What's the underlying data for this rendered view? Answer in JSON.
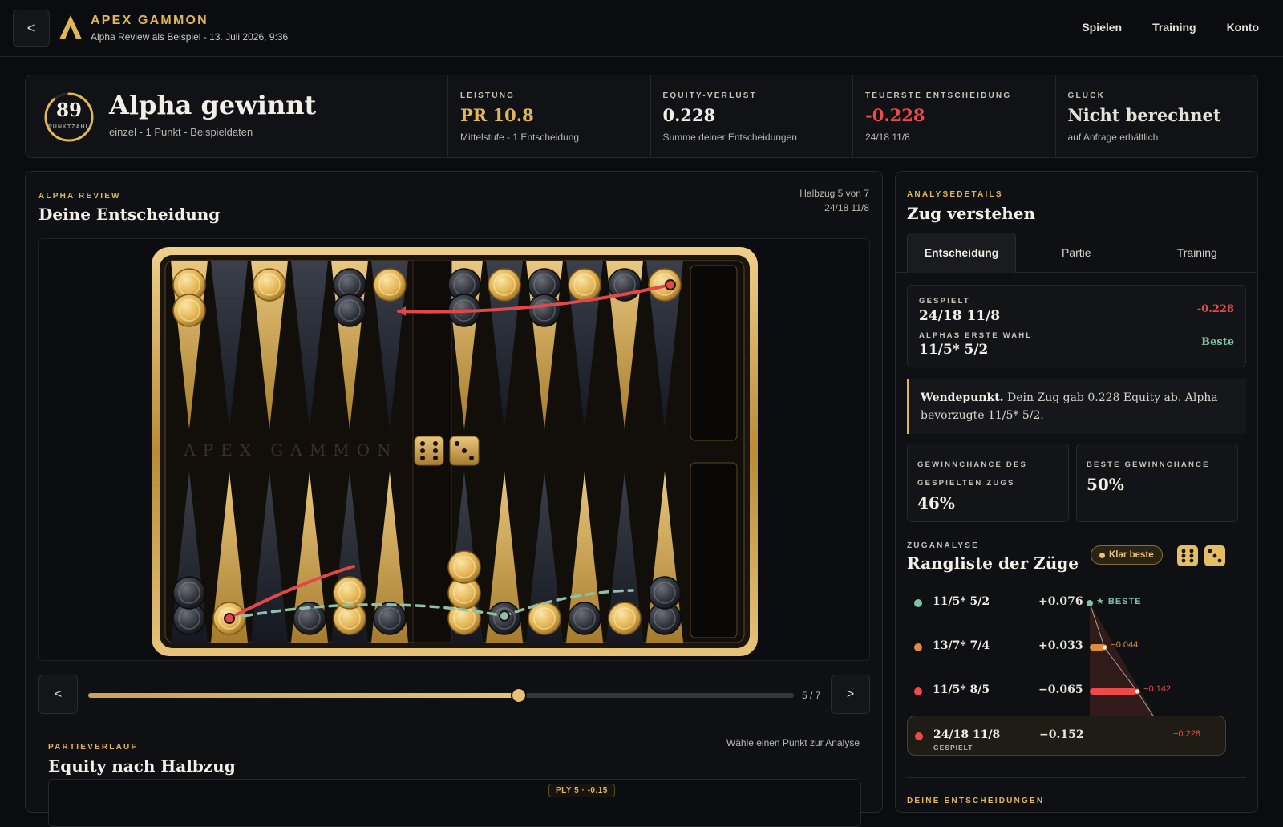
{
  "header": {
    "back_label": "<",
    "brand": "APEX GAMMON",
    "subtitle": "Alpha Review als Beispiel - 13. Juli 2026, 9:36",
    "nav": [
      "Spielen",
      "Training",
      "Konto"
    ]
  },
  "summary": {
    "score": "89",
    "score_label": "PUNKTZAHL",
    "score_fraction": 0.89,
    "result": "Alpha gewinnt",
    "result_sub": "einzel - 1 Punkt - Beispieldaten",
    "stats": [
      {
        "label": "LEISTUNG",
        "value": "PR 10.8",
        "note": "Mittelstufe - 1 Entscheidung",
        "color": "#e2b657"
      },
      {
        "label": "EQUITY-VERLUST",
        "value": "0.228",
        "note": "Summe deiner Entscheidungen",
        "color": "#f3efe6"
      },
      {
        "label": "TEUERSTE ENTSCHEIDUNG",
        "value": "-0.228",
        "note": "24/18 11/8",
        "color": "#ef4a4a"
      },
      {
        "label": "GLÜCK",
        "value": "Nicht berechnet",
        "note": "auf Anfrage erhältlich",
        "color": "#e6e2d8"
      }
    ]
  },
  "review": {
    "eyebrow": "ALPHA REVIEW",
    "title": "Deine Entscheidung",
    "meta_ply": "Halbzug 5 von 7",
    "meta_move": "24/18 11/8",
    "board_watermark": "APEX GAMMON",
    "dice": [
      6,
      3
    ],
    "prev_label": "<",
    "next_label": ">",
    "ply_current": 5,
    "ply_total": 7,
    "slider_label": "5 / 7"
  },
  "history": {
    "eyebrow": "PARTIEVERLAUF",
    "title": "Equity nach Halbzug",
    "hint": "Wähle einen Punkt zur Analyse",
    "ply_badge": "PLY 5 · -0.15"
  },
  "analysis": {
    "eyebrow": "ANALYSEDETAILS",
    "title": "Zug verstehen",
    "tabs": [
      "Entscheidung",
      "Partie",
      "Training"
    ],
    "played_label": "GESPIELT",
    "played_move": "24/18 11/8",
    "played_loss": "-0.228",
    "alpha_label": "ALPHAS ERSTE WAHL",
    "alpha_move": "11/5* 5/2",
    "alpha_best": "Beste",
    "insight_bold": "Wendepunkt.",
    "insight_text": " Dein Zug gab 0.228 Equity ab. Alpha bevorzugte 11/5* 5/2.",
    "win_played_label": "GEWINNCHANCE DES GESPIELTEN ZUGS",
    "win_played_value": "46%",
    "win_best_label": "BESTE GEWINNCHANCE",
    "win_best_value": "50%"
  },
  "moves_analysis": {
    "eyebrow": "ZUGANALYSE",
    "title": "Rangliste der Züge",
    "badge": "Klar beste",
    "moves": [
      {
        "move": "11/5* 5/2",
        "equity": "+0.076",
        "tag": "★ BESTE",
        "loss": 0,
        "color": "#7ec3a4",
        "sub": ""
      },
      {
        "move": "13/7* 7/4",
        "equity": "+0.033",
        "tag": "−0.044",
        "loss": 0.044,
        "color": "#e08c3a",
        "sub": ""
      },
      {
        "move": "11/5* 8/5",
        "equity": "−0.065",
        "tag": "−0.142",
        "loss": 0.142,
        "color": "#ef4a4a",
        "sub": ""
      },
      {
        "move": "24/18 11/8",
        "equity": "−0.152",
        "tag": "−0.228",
        "loss": 0.228,
        "color": "#ef4a4a",
        "sub": "GESPIELT"
      }
    ],
    "next_section": "DEINE ENTSCHEIDUNGEN"
  }
}
